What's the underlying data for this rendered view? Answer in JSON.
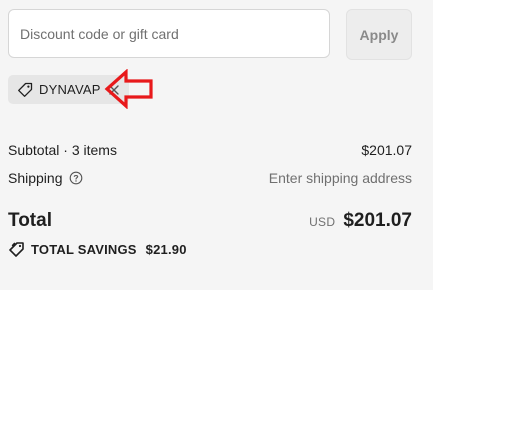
{
  "discount": {
    "placeholder": "Discount code or gift card",
    "value": "",
    "apply_label": "Apply"
  },
  "applied_code": {
    "code": "DYNAVAP",
    "icon": "tag-icon",
    "remove_icon": "close-icon"
  },
  "summary": {
    "subtotal_label": "Subtotal · 3 items",
    "subtotal_value": "$201.07",
    "shipping_label": "Shipping",
    "shipping_help_icon": "question-circle-icon",
    "shipping_value": "Enter shipping address",
    "total_label": "Total",
    "currency": "USD",
    "total_value": "$201.07"
  },
  "savings": {
    "icon": "tags-icon",
    "label": "TOTAL SAVINGS",
    "value": "$21.90"
  },
  "colors": {
    "panel_background": "#f5f5f5",
    "chip_background": "#e6e6e6",
    "annotation_arrow": "#e8191b",
    "muted_text": "#707070"
  }
}
